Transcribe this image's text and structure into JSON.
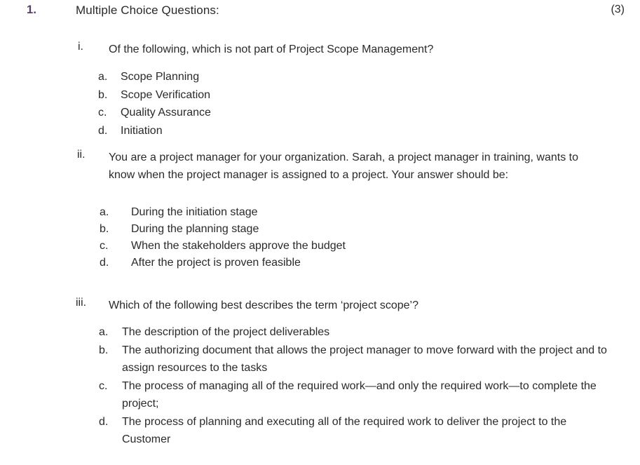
{
  "question": {
    "number": "1.",
    "title": "Multiple Choice Questions:",
    "marks": "(3)",
    "number_color": "#593f67"
  },
  "sub_questions": [
    {
      "marker": "i.",
      "stem": "Of the following, which is not part of Project Scope Management?",
      "options": [
        {
          "letter": "a.",
          "text": "Scope Planning"
        },
        {
          "letter": "b.",
          "text": "Scope Verification"
        },
        {
          "letter": "c.",
          "text": "Quality Assurance"
        },
        {
          "letter": "d.",
          "text": "Initiation"
        }
      ]
    },
    {
      "marker": "ii.",
      "stem": "You are a project manager for your organization. Sarah, a project manager in training, wants to know when the project manager is assigned to a project. Your answer should be:",
      "options": [
        {
          "letter": "a.",
          "text": "During the initiation stage"
        },
        {
          "letter": "b.",
          "text": "During the planning stage"
        },
        {
          "letter": "c.",
          "text": "When the stakeholders approve the budget"
        },
        {
          "letter": "d.",
          "text": "After the project is proven feasible"
        }
      ]
    },
    {
      "marker": "iii.",
      "stem": "Which of the following best describes the term ‘project scope’?",
      "options": [
        {
          "letter": "a.",
          "text": "The description of the project deliverables"
        },
        {
          "letter": "b.",
          "text": "The authorizing document that allows the project manager to move forward with the project and to assign resources to the tasks"
        },
        {
          "letter": "c.",
          "text": "The process of managing all of the required work—and only the required work—to complete the project;"
        },
        {
          "letter": "d.",
          "text": "The process of planning and executing all of the required work to deliver the project to the Customer"
        }
      ]
    }
  ]
}
